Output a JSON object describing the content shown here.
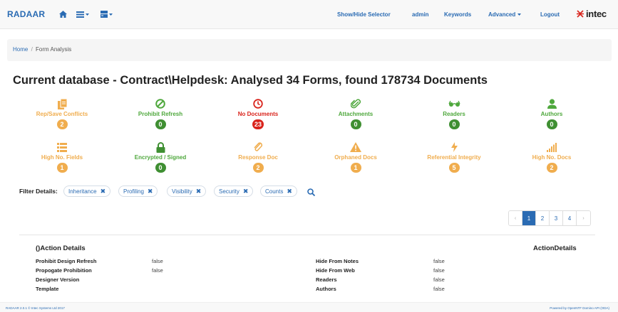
{
  "navbar": {
    "brand": "RADAAR",
    "links": [
      {
        "label": "Show/Hide Selector"
      },
      {
        "label": "admin"
      },
      {
        "label": "Keywords"
      },
      {
        "label": "Advanced"
      },
      {
        "label": "Logout"
      }
    ],
    "logo_text": "intec"
  },
  "breadcrumb": {
    "home": "Home",
    "separator": "/",
    "current": "Form Analysis"
  },
  "heading": "Current database - Contract\\Helpdesk: Analysed 34 Forms, found 178734 Documents",
  "stats": [
    {
      "label": "Rep/Save Conflicts",
      "count": "2",
      "color": "orange",
      "icon": "files-icon"
    },
    {
      "label": "Prohibit Refresh",
      "count": "0",
      "color": "green",
      "icon": "ban-icon"
    },
    {
      "label": "No Documents",
      "count": "23",
      "color": "red",
      "icon": "clock-icon"
    },
    {
      "label": "Attachments",
      "count": "0",
      "color": "green",
      "icon": "paperclip-icon"
    },
    {
      "label": "Readers",
      "count": "0",
      "color": "green",
      "icon": "glasses-icon"
    },
    {
      "label": "Authors",
      "count": "0",
      "color": "green",
      "icon": "user-icon"
    },
    {
      "label": "High No. Fields",
      "count": "1",
      "color": "orange",
      "icon": "list-icon"
    },
    {
      "label": "Encrypted / Signed",
      "count": "0",
      "color": "green",
      "icon": "lock-icon"
    },
    {
      "label": "Response Doc",
      "count": "2",
      "color": "orange",
      "icon": "reply-icon"
    },
    {
      "label": "Orphaned Docs",
      "count": "1",
      "color": "orange",
      "icon": "warning-icon"
    },
    {
      "label": "Referential Integrity",
      "count": "5",
      "color": "orange",
      "icon": "flash-icon"
    },
    {
      "label": "High No. Docs",
      "count": "2",
      "color": "orange",
      "icon": "signal-icon"
    }
  ],
  "filters": {
    "label": "Filter Details:",
    "chips": [
      {
        "label": "Inheritance",
        "remove": "✖"
      },
      {
        "label": "Profiling",
        "remove": "✖"
      },
      {
        "label": "Visibility",
        "remove": "✖"
      },
      {
        "label": "Security",
        "remove": "✖"
      },
      {
        "label": "Counts",
        "remove": "✖"
      }
    ]
  },
  "pagination": {
    "prev": "‹",
    "pages": [
      "1",
      "2",
      "3",
      "4"
    ],
    "active_page": "1",
    "next": "›"
  },
  "details": {
    "title": "()Action Details",
    "title_right": "ActionDetails",
    "left_rows": [
      {
        "key": "Prohibit Design Refresh",
        "value": "false"
      },
      {
        "key": "Propogate Prohibition",
        "value": "false"
      },
      {
        "key": "Designer Version",
        "value": ""
      },
      {
        "key": "Template",
        "value": ""
      }
    ],
    "right_rows": [
      {
        "key": "Hide From Notes",
        "value": "false"
      },
      {
        "key": "Hide From Web",
        "value": "false"
      },
      {
        "key": "Readers",
        "value": "false"
      },
      {
        "key": "Authors",
        "value": "false"
      }
    ]
  },
  "footer": {
    "left": "RADAAR 2.0.1 © Intec Systems Ltd 2017",
    "right": "Powered by OpenNTF Domino API (ODA)"
  },
  "colors": {
    "primary": "#2a6bb3",
    "warning": "#f0ad4e",
    "success": "#3f8f32",
    "danger": "#d9241c"
  }
}
